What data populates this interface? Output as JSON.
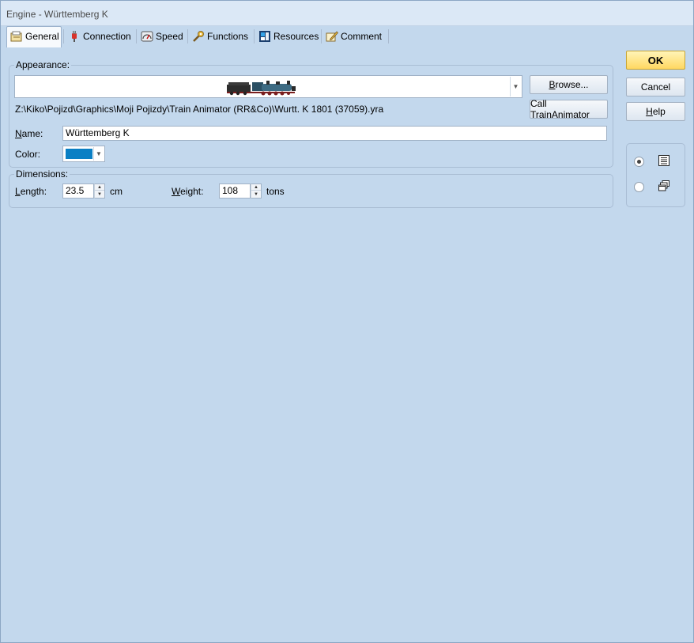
{
  "window": {
    "title": "Engine - Württemberg K"
  },
  "tabs": [
    {
      "label": "General",
      "icon": "general-icon",
      "active": true
    },
    {
      "label": "Connection",
      "icon": "plug-icon",
      "active": false
    },
    {
      "label": "Speed",
      "icon": "speedometer-icon",
      "active": false
    },
    {
      "label": "Functions",
      "icon": "functions-icon",
      "active": false
    },
    {
      "label": "Resources",
      "icon": "resources-icon",
      "active": false
    },
    {
      "label": "Comment",
      "icon": "comment-icon",
      "active": false
    }
  ],
  "appearance": {
    "group_title": "Appearance:",
    "file_path": "Z:\\Kiko\\Pojizd\\Graphics\\Moji Pojizdy\\Train Animator (RR&Co)\\Wurtt. K 1801 (37059).yra",
    "browse_label": "Browse...",
    "call_animator_label": "Call TrainAnimator",
    "name_label": "Name:",
    "name_value": "Württemberg K",
    "color_label": "Color:",
    "color_value": "#0a7fc4"
  },
  "dimensions": {
    "group_title": "Dimensions:",
    "length_label": "Length:",
    "length_value": "23.5",
    "length_unit": "cm",
    "weight_label": "Weight:",
    "weight_value": "108",
    "weight_unit": "tons"
  },
  "actions": {
    "ok_label": "OK",
    "cancel_label": "Cancel",
    "help_label": "Help"
  },
  "view_options": {
    "selected": "list-view"
  },
  "colors": {
    "background": "#c3d8ed",
    "ok_button": "#ffd861"
  }
}
